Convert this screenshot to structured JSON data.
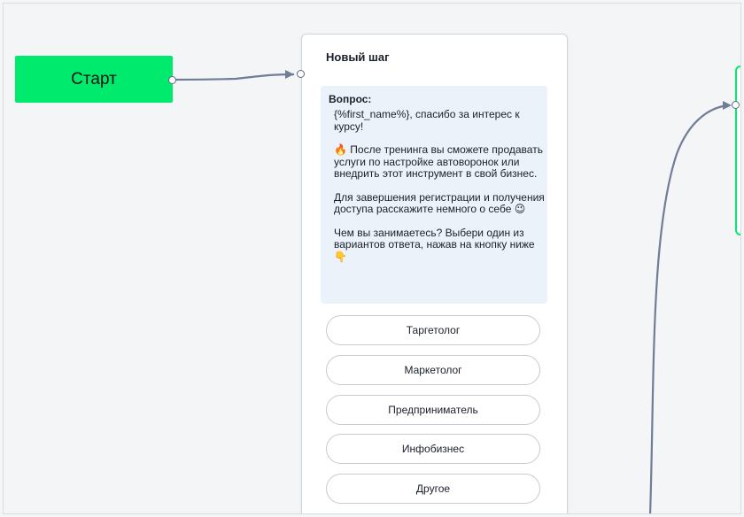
{
  "flow": {
    "start_node": {
      "label": "Старт",
      "color": "#00ea6e"
    },
    "step": {
      "title": "Новый шаг",
      "question_label": "Вопрос:",
      "question_paragraphs": [
        "{%first_name%}, спасибо за интерес к курсу!",
        "🔥 После тренинга вы сможете продавать услуги по настройке автоворонок или внедрить этот инструмент в свой бизнес.",
        "Для завершения регистрации и получения доступа расскажите немного о себе 😉",
        "Чем вы занимаетесь? Выбери один из вариантов ответа, нажав на кнопку ниже 👇"
      ],
      "answers": [
        "Таргетолог",
        "Маркетолог",
        "Предприниматель",
        "Инфобизнес",
        "Другое"
      ]
    },
    "connector_color": "#6f7d96"
  }
}
